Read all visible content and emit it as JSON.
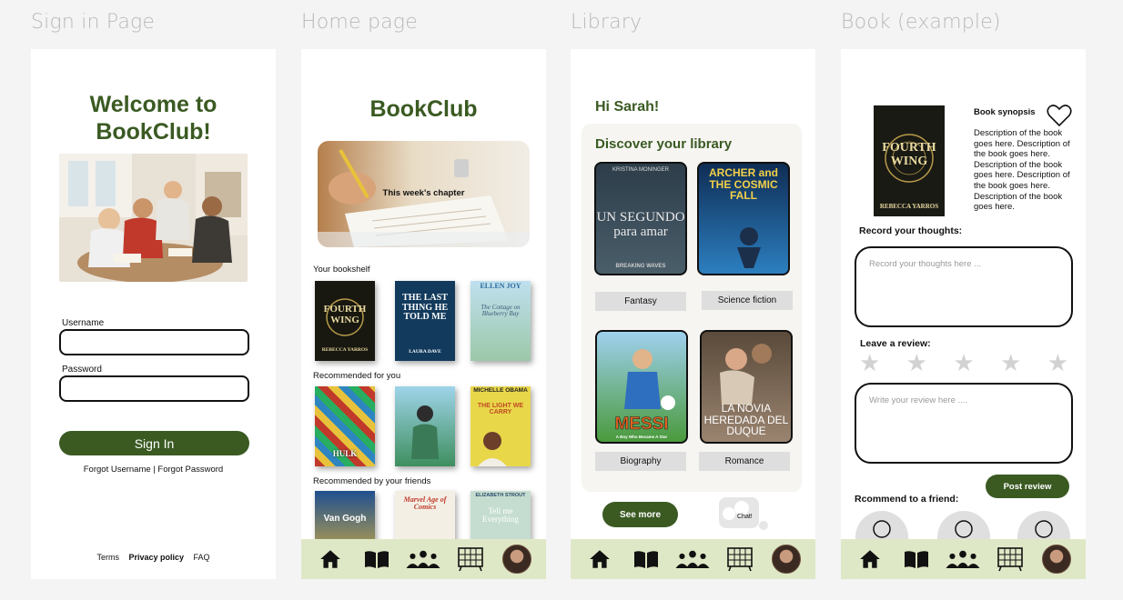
{
  "frames": {
    "signin": "Sign in Page",
    "home": "Home page",
    "library": "Library",
    "book": "Book (example)"
  },
  "signin": {
    "welcome_line1": "Welcome to",
    "welcome_line2": "BookClub!",
    "username_label": "Username",
    "password_label": "Password",
    "signin_button": "Sign In",
    "forgot_links": "Forgot Username | Forgot Password",
    "footer": {
      "terms": "Terms",
      "privacy": "Privacy policy",
      "faq": "FAQ"
    }
  },
  "home": {
    "title": "BookClub",
    "hero_label": "This week's chapter",
    "sections": [
      "Your bookshelf",
      "Recommended for you",
      "Recommended by your friends"
    ],
    "bookshelf": [
      {
        "title": "FOURTH WING",
        "author": "REBECCA YARROS"
      },
      {
        "title": "THE LAST THING HE TOLD ME",
        "author": "LAURA DAVE"
      },
      {
        "title": "The Cottage on Blueberry Bay",
        "author": "ELLEN JOY"
      }
    ],
    "recommended": [
      {
        "title": "HULK"
      },
      {
        "title": ""
      },
      {
        "title": "THE LIGHT WE CARRY",
        "author": "MICHELLE OBAMA"
      }
    ],
    "friends": [
      {
        "title": "Van Gogh"
      },
      {
        "title": "Marvel Age of Comics"
      },
      {
        "title": "Tell me Everything",
        "author": "ELIZABETH STROUT"
      }
    ]
  },
  "library": {
    "greeting": "Hi Sarah!",
    "heading": "Discover your library",
    "books": [
      {
        "title": "UN SEGUNDO para amar",
        "author": "KRISTINA MONINGER",
        "series": "BREAKING WAVES",
        "genre": "Fantasy"
      },
      {
        "title": "ARCHER and THE COSMIC FALL",
        "genre": "Science fiction"
      },
      {
        "title": "MESSI",
        "subtitle": "A Boy Who Became A Star",
        "genre": "Biography"
      },
      {
        "title": "LA NOVIA HEREDADA DEL DUQUE",
        "genre": "Romance"
      }
    ],
    "see_more": "See more",
    "chat_label": "Chat!"
  },
  "book": {
    "cover_title": "FOURTH WING",
    "cover_author": "REBECCA YARROS",
    "synopsis_title": "Book synopsis",
    "synopsis_text": "Description of the book goes here. Description of the book goes here. Description of the book goes here. Description of the book goes here. Description of the book goes here.",
    "thoughts_label": "Record your thoughts:",
    "thoughts_placeholder": "Record your thoughts here ...",
    "review_label": "Leave a review:",
    "review_placeholder": "Write your review here ....",
    "star_count": 5,
    "post_review": "Post review",
    "recommend_label": "Rcommend to a friend:"
  },
  "colors": {
    "brand_green": "#3a5a22",
    "nav_bg": "#dfe8c6",
    "canvas": "#f4f4f4"
  },
  "nav_icons": [
    "home-icon",
    "book-icon",
    "group-icon",
    "bookshelf-icon",
    "profile-avatar"
  ]
}
